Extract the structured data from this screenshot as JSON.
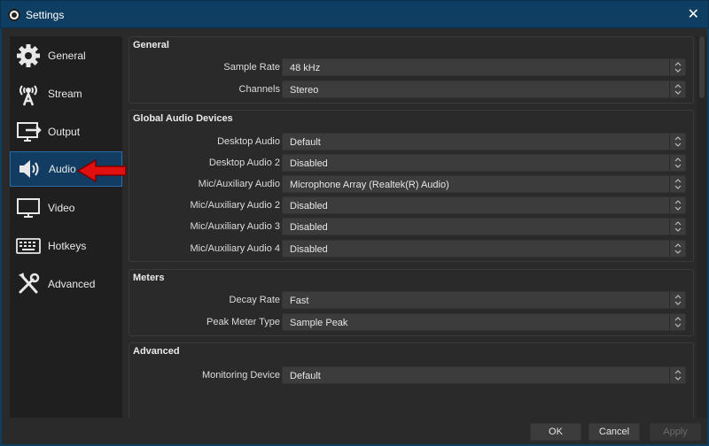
{
  "window": {
    "title": "Settings",
    "close_glyph": "✕"
  },
  "sidebar": {
    "items": [
      {
        "label": "General",
        "icon": "gear-icon"
      },
      {
        "label": "Stream",
        "icon": "antenna-icon"
      },
      {
        "label": "Output",
        "icon": "monitor-arrow-icon"
      },
      {
        "label": "Audio",
        "icon": "speaker-icon",
        "selected": true
      },
      {
        "label": "Video",
        "icon": "monitor-icon"
      },
      {
        "label": "Hotkeys",
        "icon": "keyboard-icon"
      },
      {
        "label": "Advanced",
        "icon": "tools-icon"
      }
    ]
  },
  "sections": {
    "general": {
      "title": "General",
      "rows": [
        {
          "label": "Sample Rate",
          "value": "48 kHz"
        },
        {
          "label": "Channels",
          "value": "Stereo"
        }
      ]
    },
    "global_audio": {
      "title": "Global Audio Devices",
      "rows": [
        {
          "label": "Desktop Audio",
          "value": "Default"
        },
        {
          "label": "Desktop Audio 2",
          "value": "Disabled"
        },
        {
          "label": "Mic/Auxiliary Audio",
          "value": "Microphone Array (Realtek(R) Audio)"
        },
        {
          "label": "Mic/Auxiliary Audio 2",
          "value": "Disabled"
        },
        {
          "label": "Mic/Auxiliary Audio 3",
          "value": "Disabled"
        },
        {
          "label": "Mic/Auxiliary Audio 4",
          "value": "Disabled"
        }
      ]
    },
    "meters": {
      "title": "Meters",
      "rows": [
        {
          "label": "Decay Rate",
          "value": "Fast"
        },
        {
          "label": "Peak Meter Type",
          "value": "Sample Peak"
        }
      ]
    },
    "advanced": {
      "title": "Advanced",
      "rows": [
        {
          "label": "Monitoring Device",
          "value": "Default"
        }
      ]
    }
  },
  "buttons": {
    "ok": "OK",
    "cancel": "Cancel",
    "apply": "Apply"
  },
  "colors": {
    "accent": "#133c62",
    "annotation_arrow": "#e01010"
  }
}
